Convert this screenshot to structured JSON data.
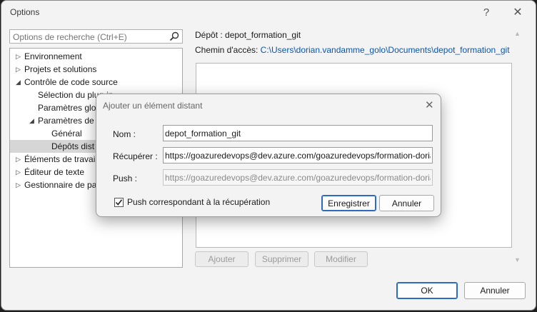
{
  "window": {
    "title": "Options",
    "help_glyph": "?",
    "close_glyph": "✕"
  },
  "search": {
    "placeholder": "Options de recherche (Ctrl+E)",
    "icon": "search-icon"
  },
  "tree": {
    "items": [
      {
        "label": "Environnement",
        "level": 0,
        "expander": "▷"
      },
      {
        "label": "Projets et solutions",
        "level": 0,
        "expander": "▷"
      },
      {
        "label": "Contrôle de code source",
        "level": 0,
        "expander": "◢"
      },
      {
        "label": "Sélection du plug-in",
        "level": 1,
        "expander": ""
      },
      {
        "label": "Paramètres glo",
        "level": 1,
        "expander": ""
      },
      {
        "label": "Paramètres de",
        "level": 1,
        "expander": "◢"
      },
      {
        "label": "Général",
        "level": 2,
        "expander": ""
      },
      {
        "label": "Dépôts dist",
        "level": 2,
        "expander": "",
        "selected": true
      },
      {
        "label": "Éléments de travai",
        "level": 0,
        "expander": "▷"
      },
      {
        "label": "Éditeur de texte",
        "level": 0,
        "expander": "▷"
      },
      {
        "label": "Gestionnaire de pa",
        "level": 0,
        "expander": "▷"
      }
    ]
  },
  "panel": {
    "depot_prefix": "Dépôt : ",
    "depot_name": "depot_formation_git",
    "path_prefix": "Chemin d'accès: ",
    "path_value": "C:\\Users\\dorian.vandamme_golo\\Documents\\depot_formation_git",
    "add_label": "Ajouter",
    "remove_label": "Supprimer",
    "edit_label": "Modifier"
  },
  "footer": {
    "ok_label": "OK",
    "cancel_label": "Annuler"
  },
  "dialog": {
    "title": "Ajouter un élément distant",
    "close_glyph": "✕",
    "name_label": "Nom :",
    "name_value": "depot_formation_git",
    "fetch_label": "Récupérer :",
    "fetch_value": "https://goazuredevops@dev.azure.com/goazuredevops/formation-dorian/_git/depot_formation_git",
    "push_label": "Push :",
    "push_value": "https://goazuredevops@dev.azure.com/goazuredevops/formation-dorian/_git/depot_formation_git",
    "push_match_label": "Push correspondant à la récupération",
    "push_match_checked": true,
    "save_label": "Enregistrer",
    "cancel_label": "Annuler"
  },
  "colors": {
    "link": "#0b56a6",
    "primary_border": "#2f6bbd"
  }
}
